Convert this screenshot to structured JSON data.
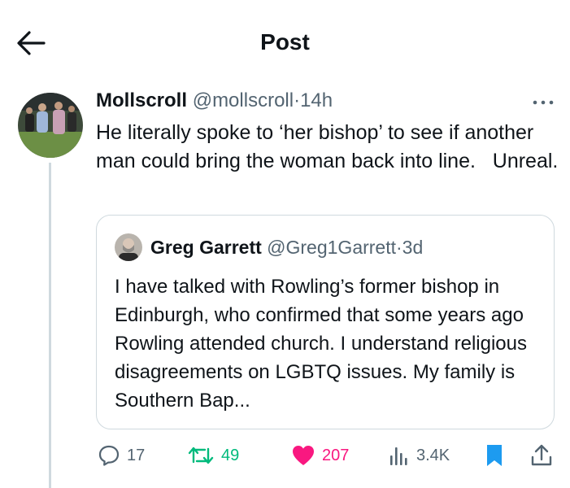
{
  "header": {
    "title": "Post"
  },
  "post": {
    "display_name": "Mollscroll",
    "handle": "@mollscroll",
    "separator": "·",
    "time": "14h",
    "text": "He literally spoke to ‘her bishop’ to see if another man could bring the woman back into line.   Unreal."
  },
  "quote": {
    "display_name": "Greg Garrett",
    "handle": "@Greg1Garrett",
    "separator": "·",
    "time": "3d",
    "text": "I have talked with Rowling’s former bishop in Edinburgh, who confirmed that some years ago Rowling attended church. I understand religious disagreements on LGBTQ issues. My family is Southern Bap..."
  },
  "actions": {
    "replies": "17",
    "reposts": "49",
    "likes": "207",
    "views": "3.4K"
  },
  "colors": {
    "repost": "#00ba7c",
    "like": "#f91880",
    "bookmark": "#1d9bf0",
    "muted": "#536471",
    "text": "#0f1419",
    "border": "#cfd9de"
  }
}
